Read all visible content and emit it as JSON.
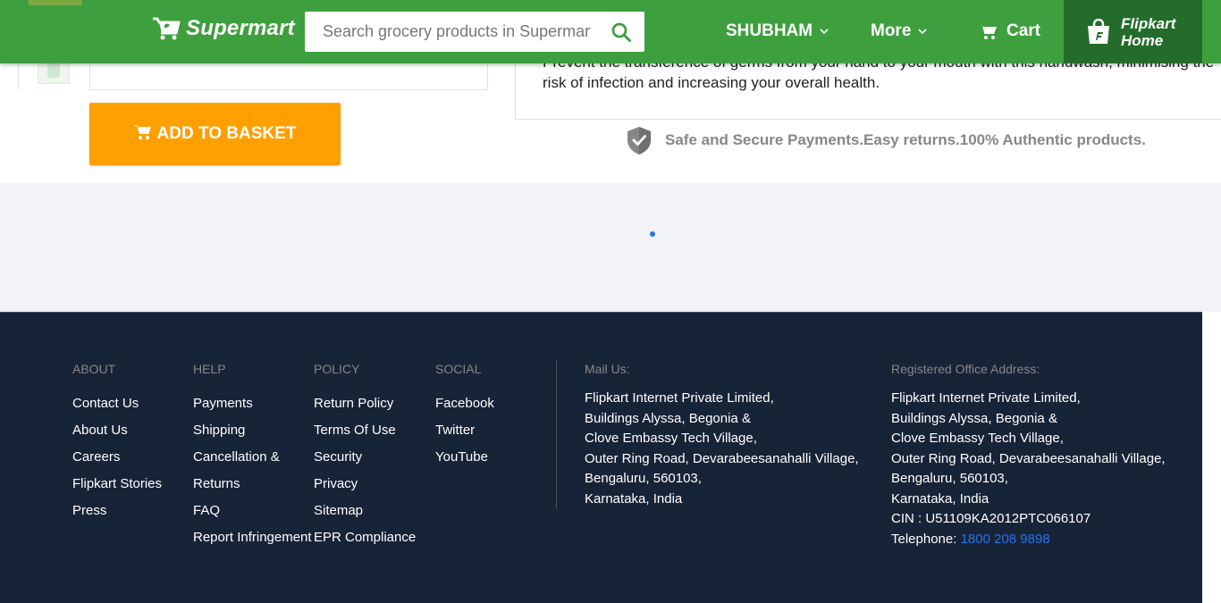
{
  "header": {
    "logo_text": "Supermart",
    "search_placeholder": "Search grocery products in Supermart",
    "account_label": "SHUBHAM",
    "more_label": "More",
    "cart_label": "Cart",
    "flipkart_home_line1": "Flipkart",
    "flipkart_home_line2": "Home",
    "brand_color": "#3e9f3e",
    "flipkart_home_color": "#236c2b"
  },
  "product": {
    "add_to_basket_label": "ADD TO BASKET",
    "description": "Prevent the transference of germs from your hand to your mouth with this handwash, minimising the risk of infection and increasing your overall health.",
    "secure_text": "Safe and Secure Payments.Easy returns.100% Authentic products."
  },
  "footer": {
    "about": {
      "title": "ABOUT",
      "links": [
        "Contact Us",
        "About Us",
        "Careers",
        "Flipkart Stories",
        "Press"
      ]
    },
    "help": {
      "title": "HELP",
      "links": [
        "Payments",
        "Shipping",
        "Cancellation &",
        "Returns",
        "FAQ",
        "Report Infringement"
      ]
    },
    "policy": {
      "title": "POLICY",
      "links": [
        "Return Policy",
        "Terms Of Use",
        "Security",
        "Privacy",
        "Sitemap",
        "EPR Compliance"
      ]
    },
    "social": {
      "title": "SOCIAL",
      "links": [
        "Facebook",
        "Twitter",
        "YouTube"
      ]
    },
    "mail": {
      "title": "Mail Us:",
      "lines": [
        "Flipkart Internet Private Limited,",
        "Buildings Alyssa, Begonia &",
        "Clove Embassy Tech Village,",
        "Outer Ring Road, Devarabeesanahalli Village,",
        "Bengaluru, 560103,",
        "Karnataka, India"
      ]
    },
    "office": {
      "title": "Registered Office Address:",
      "lines": [
        "Flipkart Internet Private Limited,",
        "Buildings Alyssa, Begonia &",
        "Clove Embassy Tech Village,",
        "Outer Ring Road, Devarabeesanahalli Village,",
        "Bengaluru, 560103,",
        "Karnataka, India",
        "CIN : U51109KA2012PTC066107"
      ],
      "telephone_label": "Telephone:",
      "telephone_number": "1800 208 9898"
    }
  }
}
